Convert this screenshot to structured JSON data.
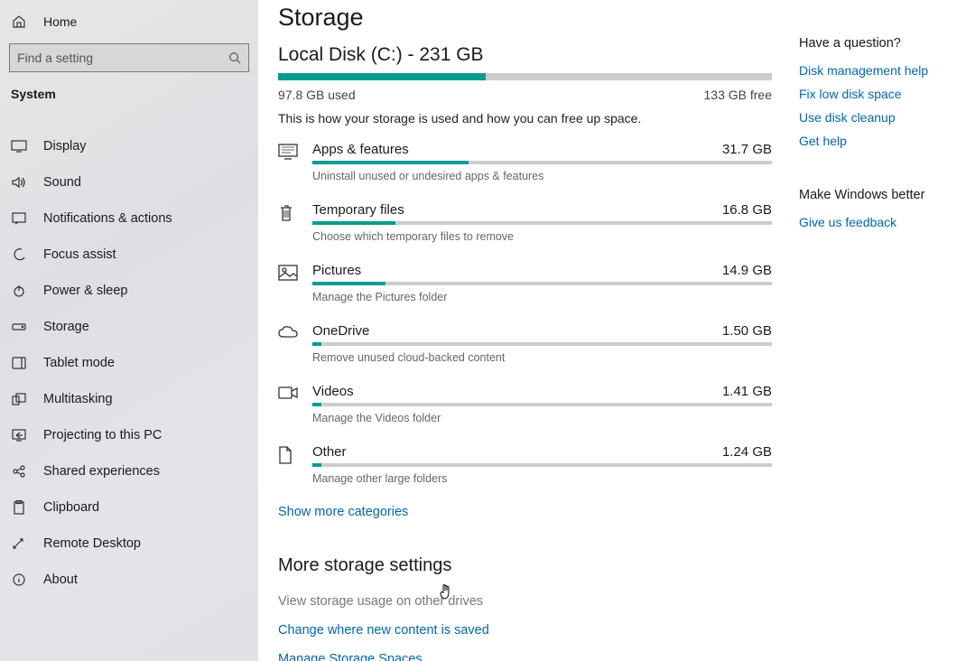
{
  "sidebar": {
    "home": "Home",
    "search_placeholder": "Find a setting",
    "section": "System",
    "items": [
      {
        "label": "Display"
      },
      {
        "label": "Sound"
      },
      {
        "label": "Notifications & actions"
      },
      {
        "label": "Focus assist"
      },
      {
        "label": "Power & sleep"
      },
      {
        "label": "Storage"
      },
      {
        "label": "Tablet mode"
      },
      {
        "label": "Multitasking"
      },
      {
        "label": "Projecting to this PC"
      },
      {
        "label": "Shared experiences"
      },
      {
        "label": "Clipboard"
      },
      {
        "label": "Remote Desktop"
      },
      {
        "label": "About"
      }
    ]
  },
  "page": {
    "title": "Storage",
    "disk_title": "Local Disk (C:) - 231 GB",
    "used_label": "97.8 GB used",
    "free_label": "133 GB free",
    "desc": "This is how your storage is used and how you can free up space.",
    "categories": [
      {
        "name": "Apps & features",
        "size": "31.7 GB",
        "sub": "Uninstall unused or undesired apps & features",
        "pct": 34
      },
      {
        "name": "Temporary files",
        "size": "16.8 GB",
        "sub": "Choose which temporary files to remove",
        "pct": 18
      },
      {
        "name": "Pictures",
        "size": "14.9 GB",
        "sub": "Manage the Pictures folder",
        "pct": 16
      },
      {
        "name": "OneDrive",
        "size": "1.50 GB",
        "sub": "Remove unused cloud-backed content",
        "pct": 2
      },
      {
        "name": "Videos",
        "size": "1.41 GB",
        "sub": "Manage the Videos folder",
        "pct": 2
      },
      {
        "name": "Other",
        "size": "1.24 GB",
        "sub": "Manage other large folders",
        "pct": 2
      }
    ],
    "show_more": "Show more categories",
    "more_heading": "More storage settings",
    "more_links": {
      "view_other": "View storage usage on other drives",
      "change_where": "Change where new content is saved",
      "manage_spaces": "Manage Storage Spaces"
    }
  },
  "right": {
    "question": "Have a question?",
    "links": [
      "Disk management help",
      "Fix low disk space",
      "Use disk cleanup",
      "Get help"
    ],
    "better": "Make Windows better",
    "feedback": "Give us feedback"
  }
}
